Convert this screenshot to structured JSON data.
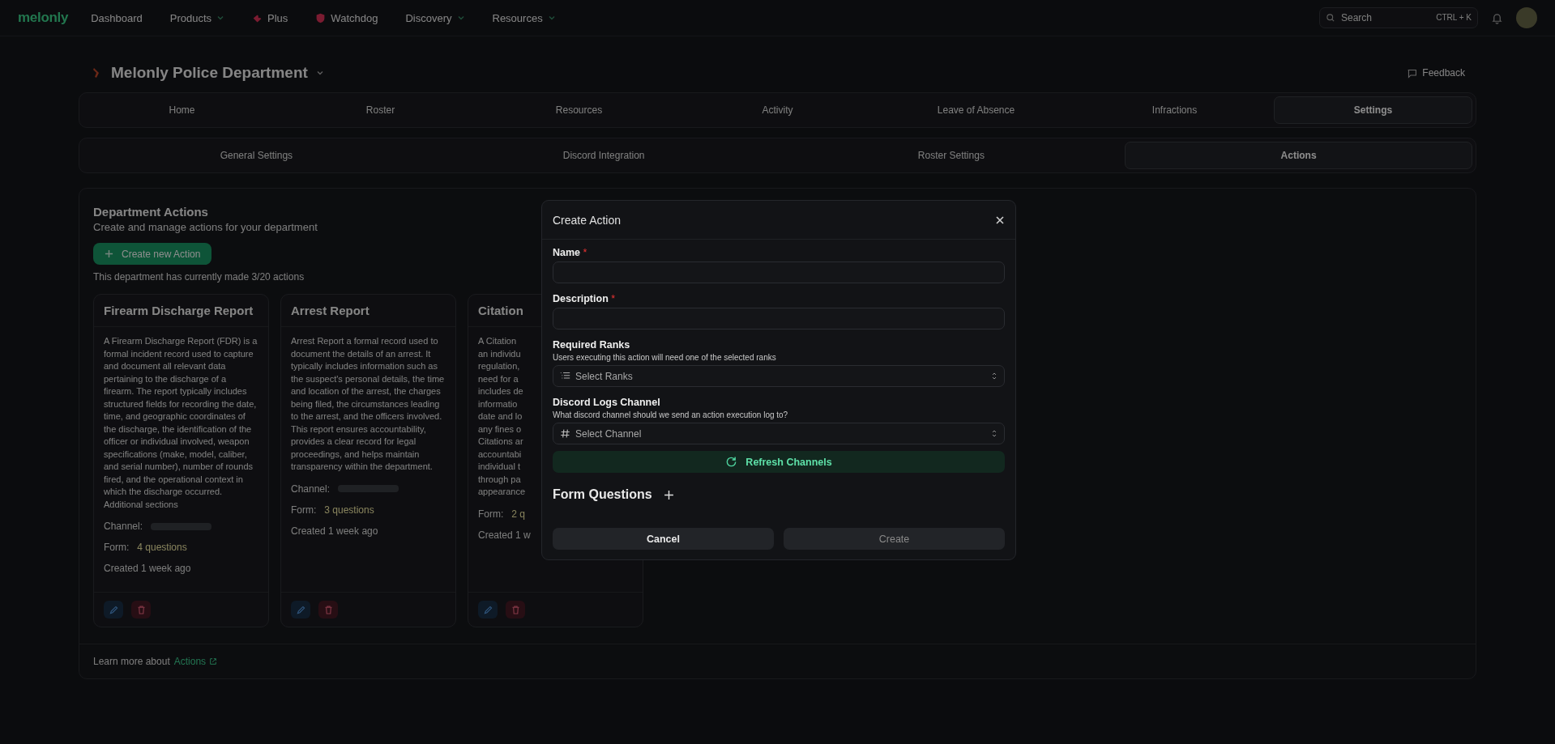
{
  "nav": {
    "logo": "melonly",
    "items": [
      {
        "label": "Dashboard",
        "kind": "link"
      },
      {
        "label": "Products",
        "kind": "dropdown"
      },
      {
        "label": "Plus",
        "kind": "plus"
      },
      {
        "label": "Watchdog",
        "kind": "watchdog"
      },
      {
        "label": "Discovery",
        "kind": "dropdown"
      },
      {
        "label": "Resources",
        "kind": "dropdown"
      }
    ],
    "search": {
      "placeholder": "Search",
      "shortcut": "CTRL + K"
    }
  },
  "header": {
    "title": "Melonly Police Department",
    "feedback": "Feedback"
  },
  "tabs": [
    {
      "label": "Home",
      "selected": false
    },
    {
      "label": "Roster",
      "selected": false
    },
    {
      "label": "Resources",
      "selected": false
    },
    {
      "label": "Activity",
      "selected": false
    },
    {
      "label": "Leave of Absence",
      "selected": false
    },
    {
      "label": "Infractions",
      "selected": false
    },
    {
      "label": "Settings",
      "selected": true
    }
  ],
  "subtabs": [
    {
      "label": "General Settings",
      "selected": false
    },
    {
      "label": "Discord Integration",
      "selected": false
    },
    {
      "label": "Roster Settings",
      "selected": false
    },
    {
      "label": "Actions",
      "selected": true
    }
  ],
  "section": {
    "title": "Department Actions",
    "subtitle": "Create and manage actions for your department",
    "create_button": "Create new Action",
    "usage": "This department has currently made 3/20 actions",
    "footer_text": "Learn more about",
    "footer_link": "Actions"
  },
  "actions": [
    {
      "title": "Firearm Discharge Report",
      "description": "A Firearm Discharge Report (FDR) is a formal incident record used to capture and document all relevant data pertaining to the discharge of a firearm. The report typically includes structured fields for recording the date, time, and geographic coordinates of the discharge, the identification of the officer or individual involved, weapon specifications (make, model, caliber, and serial number), number of rounds fired, and the operational context in which the discharge occurred. Additional sections",
      "channel_label": "Channel:",
      "form_label": "Form:",
      "form_value": "4 questions",
      "created": "Created 1 week ago"
    },
    {
      "title": "Arrest Report",
      "description": "Arrest Report a formal record used to document the details of an arrest. It typically includes information such as the suspect's personal details, the time and location of the arrest, the charges being filed, the circumstances leading to the arrest, and the officers involved. This report ensures accountability, provides a clear record for legal proceedings, and helps maintain transparency within the department.",
      "channel_label": "Channel:",
      "form_label": "Form:",
      "form_value": "3 questions",
      "created": "Created 1 week ago"
    },
    {
      "title": "Citation",
      "description_lines": [
        "A Citation",
        "an individu",
        "regulation,",
        "need for a",
        "includes de",
        "informatio",
        "date and lo",
        "any fines o",
        "Citations ar",
        "accountabi",
        "individual t",
        "through pa",
        "appearance"
      ],
      "form_label": "Form:",
      "form_value": "2 q",
      "created": "Created 1 w"
    }
  ],
  "modal": {
    "title": "Create Action",
    "fields": [
      {
        "kind": "text",
        "label": "Name",
        "required_mark": "*"
      },
      {
        "kind": "text",
        "label": "Description",
        "required_mark": "*"
      },
      {
        "kind": "multiselect",
        "label": "Required Ranks",
        "hint": "Users executing this action will need one of the selected ranks",
        "placeholder": "Select Ranks"
      },
      {
        "kind": "channelselect",
        "label": "Discord Logs Channel",
        "hint": "What discord channel should we send an action execution log to?",
        "placeholder": "Select Channel"
      }
    ],
    "refresh_button": "Refresh Channels",
    "questions_title": "Form Questions",
    "cancel": "Cancel",
    "create": {
      "label": "Create",
      "disabled": true
    }
  }
}
